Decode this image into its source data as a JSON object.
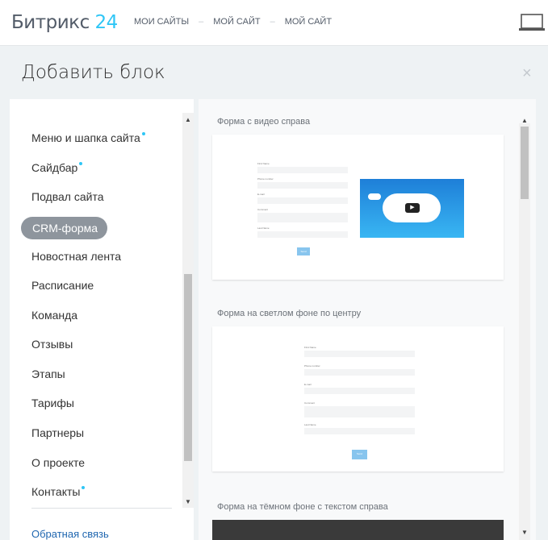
{
  "header": {
    "logo_text": "Битрикс",
    "logo_num": "24",
    "breadcrumbs": [
      "МОИ САЙТЫ",
      "МОЙ САЙТ",
      "МОЙ САЙТ"
    ],
    "separator": "–"
  },
  "dialog": {
    "title": "Добавить блок",
    "close": "×"
  },
  "sidebar": {
    "items": [
      {
        "label": "Меню и шапка сайта",
        "new": true
      },
      {
        "label": "Сайдбар",
        "new": true
      },
      {
        "label": "Подвал сайта",
        "new": false
      },
      {
        "label": "CRM-форма",
        "new": false,
        "selected": true
      },
      {
        "label": "Новостная лента",
        "new": false
      },
      {
        "label": "Расписание",
        "new": false
      },
      {
        "label": "Команда",
        "new": false
      },
      {
        "label": "Отзывы",
        "new": false
      },
      {
        "label": "Этапы",
        "new": false
      },
      {
        "label": "Тарифы",
        "new": false
      },
      {
        "label": "Партнеры",
        "new": false
      },
      {
        "label": "О проекте",
        "new": false
      },
      {
        "label": "Контакты",
        "new": true
      }
    ],
    "feedback": "Обратная связь"
  },
  "blocks": [
    {
      "title": "Форма с видео справа"
    },
    {
      "title": "Форма на светлом фоне по центру"
    },
    {
      "title": "Форма на тёмном фоне с текстом справа"
    }
  ],
  "form": {
    "fields": [
      "First Name",
      "Phone number",
      "E-mail",
      "Comment",
      "Last Name"
    ],
    "button": "Send"
  },
  "colors": {
    "accent": "#2fc6f6",
    "highlight": "#d52b2b",
    "link": "#2067b0"
  }
}
